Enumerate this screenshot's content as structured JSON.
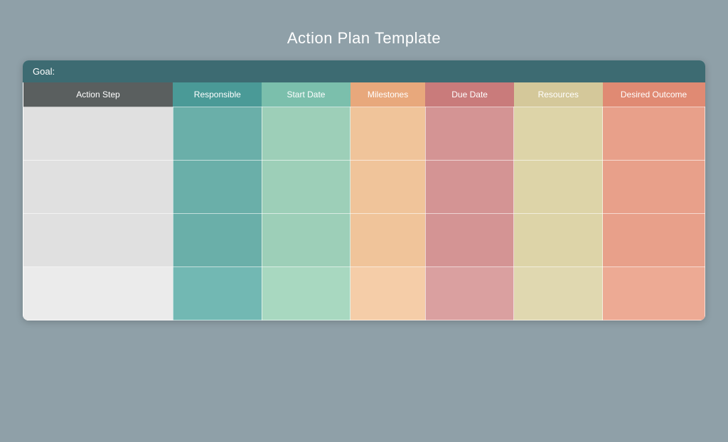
{
  "page": {
    "title": "Action Plan Template"
  },
  "goal_bar": {
    "label": "Goal:"
  },
  "columns": [
    {
      "id": "action",
      "label": "Action Step",
      "class": "col-action"
    },
    {
      "id": "resp",
      "label": "Responsible",
      "class": "col-resp"
    },
    {
      "id": "start",
      "label": "Start Date",
      "class": "col-start"
    },
    {
      "id": "mile",
      "label": "Milestones",
      "class": "col-mile"
    },
    {
      "id": "due",
      "label": "Due Date",
      "class": "col-due"
    },
    {
      "id": "res",
      "label": "Resources",
      "class": "col-res"
    },
    {
      "id": "desired",
      "label": "Desired Outcome",
      "class": "col-desired"
    }
  ],
  "rows": [
    {
      "id": "row1"
    },
    {
      "id": "row2"
    },
    {
      "id": "row3"
    },
    {
      "id": "row4"
    }
  ]
}
